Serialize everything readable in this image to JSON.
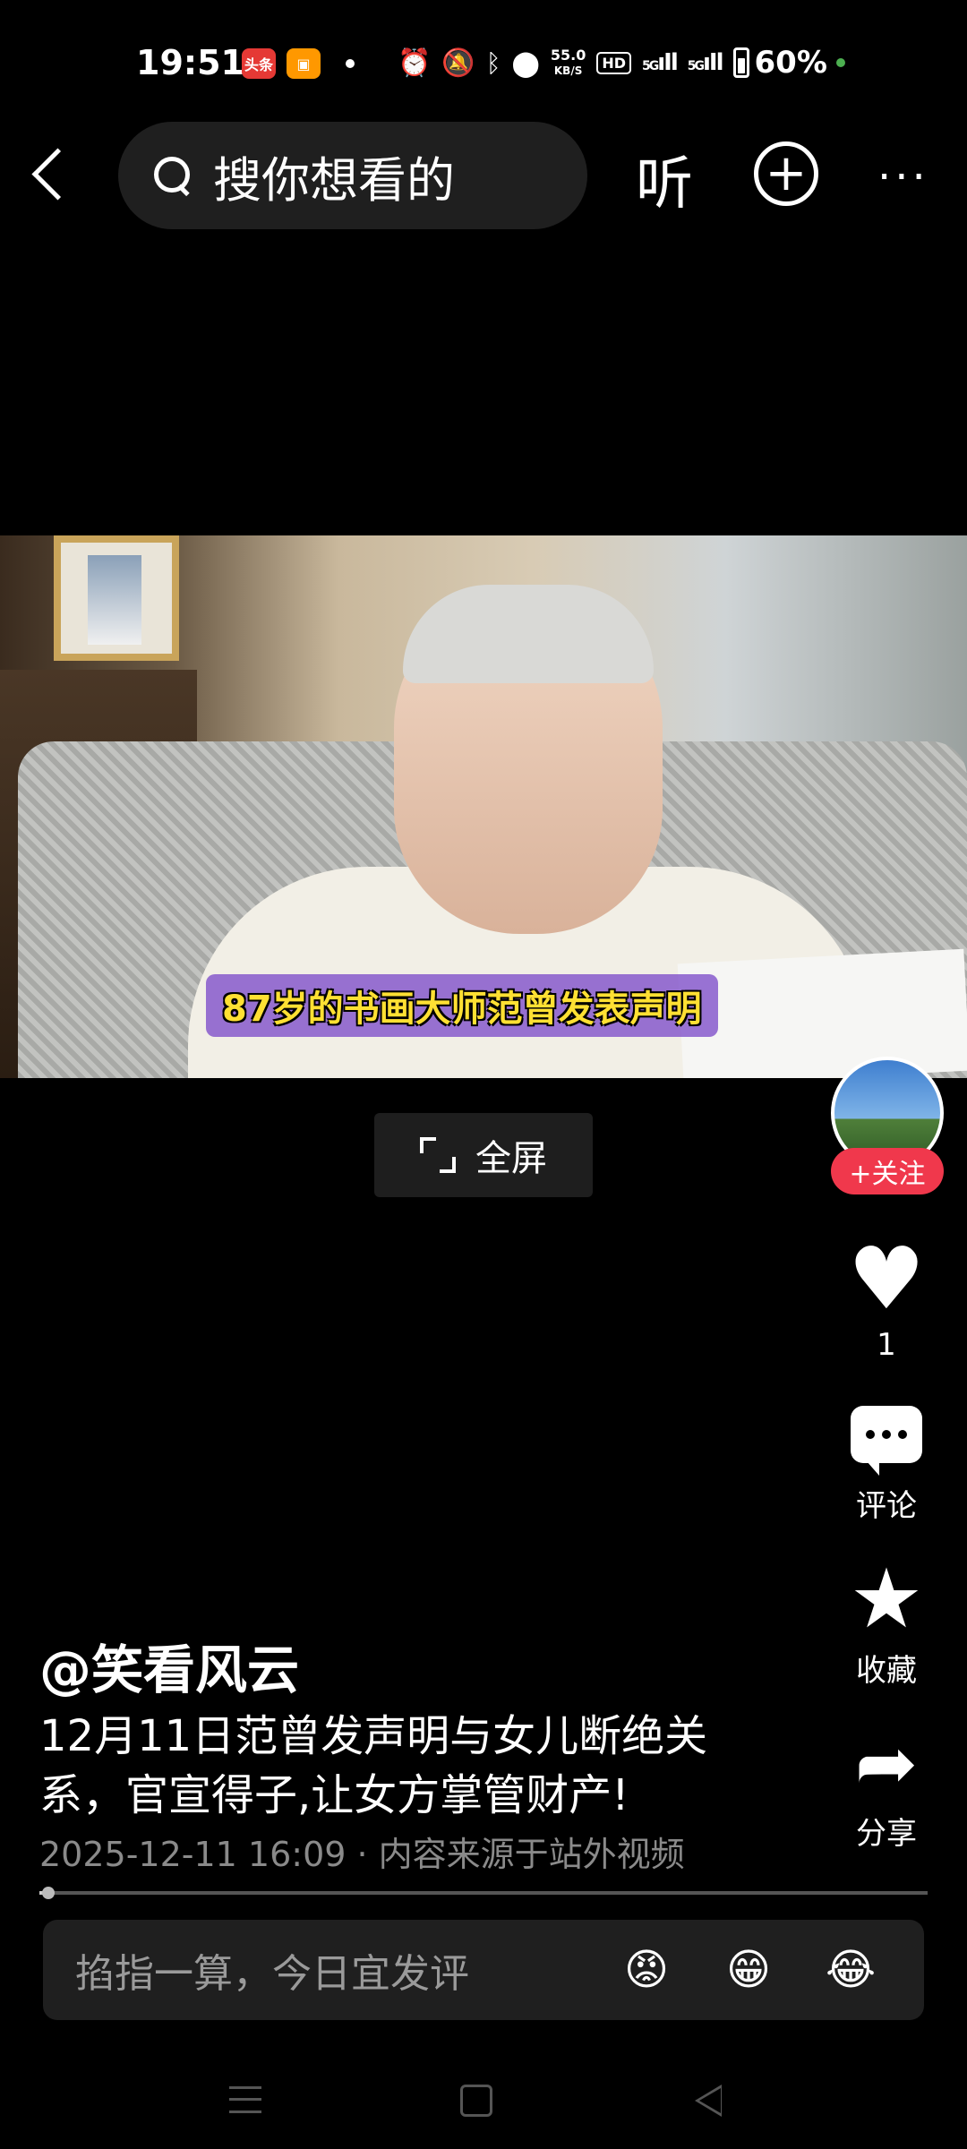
{
  "status_bar": {
    "time": "19:51",
    "app_badge_1": "头条",
    "app_badge_2": "▣",
    "net_speed_value": "55.0",
    "net_speed_unit": "KB/S",
    "hd": "HD",
    "signal_1": "5G",
    "signal_2": "5G",
    "battery": "60%"
  },
  "header": {
    "search_placeholder": "搜你想看的",
    "listen_label": "听"
  },
  "video": {
    "subtitle": "87岁的书画大师范曾发表声明",
    "fullscreen_label": "全屏"
  },
  "rail": {
    "follow_label": "+关注",
    "like_count": "1",
    "comment_label": "评论",
    "favorite_label": "收藏",
    "share_label": "分享"
  },
  "post": {
    "author": "@笑看风云",
    "caption": "12月11日范曾发声明与女儿断绝关系，官宣得子,让女方掌管财产!",
    "meta": "2025-12-11 16:09 · 内容来源于站外视频",
    "progress": 0.01
  },
  "comment_bar": {
    "placeholder": "掐指一算，今日宜发评",
    "emojis": [
      "😡",
      "😁",
      "😂"
    ]
  },
  "colors": {
    "accent_red": "#f0384c",
    "subtitle_yellow": "#ffe033"
  }
}
